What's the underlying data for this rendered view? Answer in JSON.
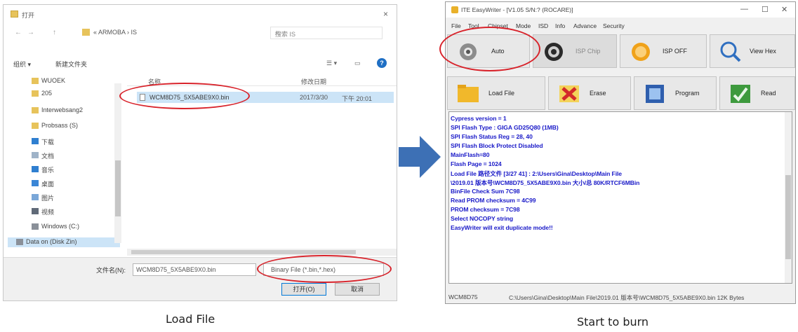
{
  "dialog": {
    "title": "打开",
    "close": "×",
    "nav_back": "←",
    "nav_forward": "→",
    "nav_up": "↑",
    "path_text": "« ARMOBA ›  IS",
    "search_placeholder": "搜索 IS",
    "organize": "组织 ▾",
    "new_folder": "新建文件夹",
    "help": "?",
    "nav_items": [
      "WUOEK",
      "205",
      "Interwebsang2",
      "Probsass (S)",
      "下载",
      "文档",
      "音乐",
      "桌面",
      "图片",
      "视频",
      "Windows (C:)",
      "Data on (Disk Zin)"
    ],
    "col_name": "名称",
    "col_date": "修改日期",
    "file": {
      "name": "WCM8D75_5X5ABE9X0.bin",
      "date": "2017/3/30",
      "time": "下午 20:01"
    },
    "filename_label": "文件名(N):",
    "filename_value": "WCM8D75_5X5ABE9X0.bin",
    "filter_value": "Binary File (*.bin,*.hex)",
    "open_button": "打开(O)",
    "cancel_button": "取消"
  },
  "captions": {
    "left": "Load File",
    "right": "Start to burn"
  },
  "app": {
    "title": "ITE EasyWriter - [V1.05 S/N:? (ROCARE)]",
    "menu": [
      "File",
      "Tool",
      "Chipset",
      "Mode",
      "ISD",
      "Info",
      "Advance",
      "Security"
    ],
    "toolbar_row1": [
      "Auto",
      "ISP Chip",
      "ISP OFF",
      "View Hex"
    ],
    "toolbar_row2": [
      "Load File",
      "Erase",
      "Program",
      "Read"
    ],
    "log_lines": [
      "Cypress version = 1",
      "SPI Flash Type : GIGA GD25Q80 (1MB)",
      "SPI Flash Status Reg = 28, 40",
      "SPI Flash Block Protect Disabled",
      "MainFlash=80",
      "Flash Page = 1024",
      "Load File 路径文件 [3/27 41] : 2:\\Users\\Gina\\Desktop\\Main File",
      "\\2019.01 版本号\\WCM8D75_5X5ABE9X0.bin 大小/总 80K/RTCF6MBin",
      "BinFile Check Sum 7C98",
      "Read PROM checksum = 4C99",
      "PROM checksum = 7C98",
      "Select NOCOPY string",
      "EasyWriter will exit duplicate mode!!"
    ],
    "status_left": "WCM8D75",
    "status_right": "C:\\Users\\Gina\\Desktop\\Main File\\2019.01 版本号\\WCM8D75_5X5ABE9X0.bin 12K Bytes"
  }
}
